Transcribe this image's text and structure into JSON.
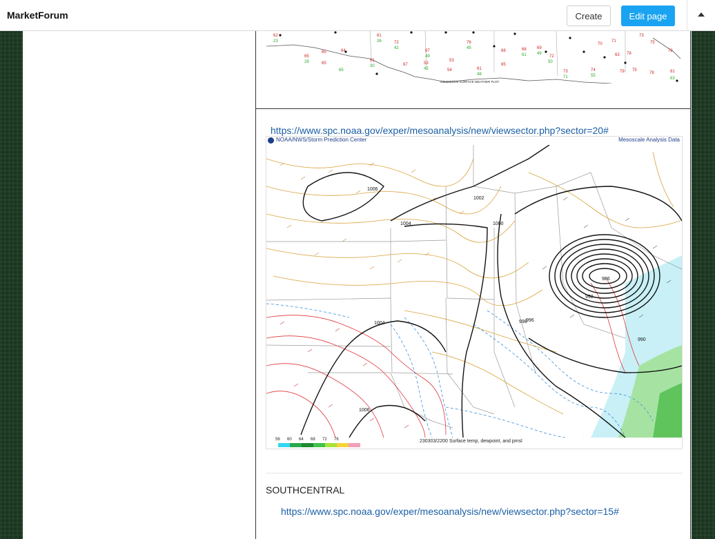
{
  "header": {
    "brand": "MarketForum",
    "create_label": "Create",
    "edit_label": "Edit page"
  },
  "post": {
    "map1_caption": "230303/2200 SURFACE WEATHER PLOT",
    "link1": "https://www.spc.noaa.gov/exper/mesoanalysis/new/viewsector.php?sector=20#",
    "map2_header_left": "NOAA/NWS/Storm Prediction Center",
    "map2_header_right": "Mesoscale Analysis Data",
    "map2_caption": "230303/2200 Surface temp, dewpoint, and pmsl",
    "colorbar_labels": [
      "56",
      "60",
      "64",
      "68",
      "72",
      "76"
    ],
    "colorbar_colors": [
      "#33d6f2",
      "#2ba84a",
      "#1f8a33",
      "#41c24a",
      "#a9e33a",
      "#f4d23a",
      "#f2a0b8"
    ],
    "isobar_labels": [
      "1006",
      "1004",
      "1002",
      "1000",
      "998",
      "996",
      "992",
      "990",
      "986",
      "1004",
      "1006"
    ],
    "section_title": "SOUTHCENTRAL",
    "link2": "https://www.spc.noaa.gov/exper/mesoanalysis/new/viewsector.php?sector=15#"
  }
}
